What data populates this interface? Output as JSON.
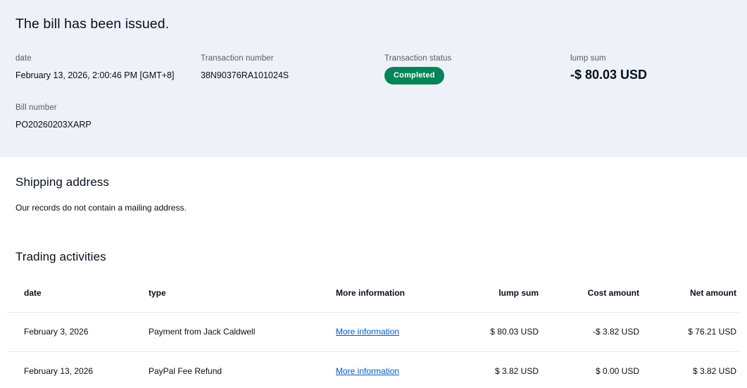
{
  "page": {
    "title": "The bill has been issued."
  },
  "summary": {
    "fields": [
      {
        "label": "date",
        "value": "February 13, 2026, 2:00:46 PM [GMT+8]"
      },
      {
        "label": "Transaction number",
        "value": "38N90376RA101024S"
      },
      {
        "label": "Transaction status",
        "badge": "Completed"
      },
      {
        "label": "lump sum",
        "value": "-$ 80.03 USD"
      },
      {
        "label": "Bill number",
        "value": "PO20260203XARP"
      }
    ]
  },
  "shipping": {
    "heading": "Shipping address",
    "note": "Our records do not contain a mailing address."
  },
  "activities": {
    "heading": "Trading activities",
    "columns": [
      "date",
      "type",
      "More information",
      "lump sum",
      "Cost amount",
      "Net amount"
    ],
    "rows": [
      {
        "date": "February 3, 2026",
        "type": "Payment from Jack Caldwell",
        "link": "More information",
        "lump_sum": "$ 80.03 USD",
        "cost_amount": "-$ 3.82 USD",
        "net_amount": "$ 76.21 USD"
      },
      {
        "date": "February 13, 2026",
        "type": "PayPal Fee Refund",
        "link": "More information",
        "lump_sum": "$ 3.82 USD",
        "cost_amount": "$ 0.00 USD",
        "net_amount": "$ 3.82 USD"
      }
    ]
  },
  "colors": {
    "summary_background": "#eef1f8",
    "badge_green": "#008559",
    "link_blue": "#0059c7",
    "divider": "#e6e8eb"
  }
}
